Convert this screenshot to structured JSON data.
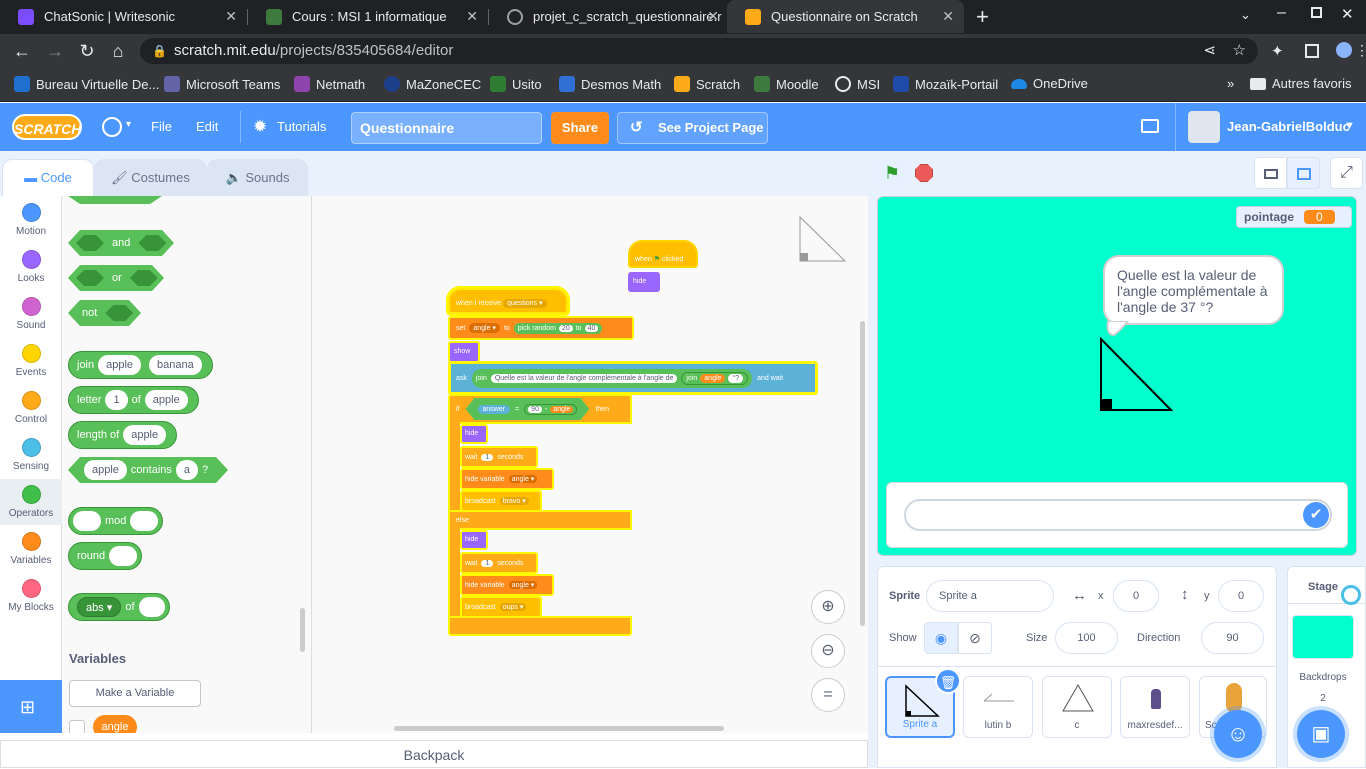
{
  "browser": {
    "tabs": [
      {
        "title": "ChatSonic | Writesonic",
        "color": "#7b4dff"
      },
      {
        "title": "Cours : MSI 1 informatique",
        "color": "#3d7a3d"
      },
      {
        "title": "projet_c_scratch_questionnaire.r",
        "color": "#5f6368"
      },
      {
        "title": "Questionnaire on Scratch",
        "color": "#ffab19"
      }
    ],
    "url_host": "scratch.mit.edu",
    "url_path": "/projects/835405684/editor",
    "bookmarks": [
      {
        "label": "Bureau Virtuelle De...",
        "color": "#1f6fd1"
      },
      {
        "label": "Microsoft Teams",
        "color": "#6264a7"
      },
      {
        "label": "Netmath",
        "color": "#8e44ad"
      },
      {
        "label": "MaZoneCEC",
        "color": "#1d3f8a"
      },
      {
        "label": "Usito",
        "color": "#2e7d32"
      },
      {
        "label": "Desmos Math",
        "color": "#2f6fd6"
      },
      {
        "label": "Scratch",
        "color": "#ffab19"
      },
      {
        "label": "Moodle",
        "color": "#3d7a3d"
      },
      {
        "label": "MSI",
        "color": "#e8eaed"
      },
      {
        "label": "Mozaïk-Portail",
        "color": "#1f4aa8"
      },
      {
        "label": "OneDrive",
        "color": "#1e88e5"
      }
    ],
    "other_bookmarks": "Autres favoris"
  },
  "menubar": {
    "logo": "SCRATCH",
    "file": "File",
    "edit": "Edit",
    "tutorials": "Tutorials",
    "project_title": "Questionnaire",
    "share": "Share",
    "see_project": "See Project Page",
    "username": "Jean-GabrielBolduc"
  },
  "editor_tabs": {
    "code": "Code",
    "costumes": "Costumes",
    "sounds": "Sounds"
  },
  "categories": [
    {
      "label": "Motion",
      "color": "#4c97ff"
    },
    {
      "label": "Looks",
      "color": "#9966ff"
    },
    {
      "label": "Sound",
      "color": "#cf63cf"
    },
    {
      "label": "Events",
      "color": "#ffd500"
    },
    {
      "label": "Control",
      "color": "#ffab19"
    },
    {
      "label": "Sensing",
      "color": "#4cbfe6"
    },
    {
      "label": "Operators",
      "color": "#40bf4a"
    },
    {
      "label": "Variables",
      "color": "#ff8c1a"
    },
    {
      "label": "My Blocks",
      "color": "#ff6680"
    }
  ],
  "palette": {
    "and": "and",
    "or": "or",
    "not": "not",
    "join": "join",
    "join_a": "apple",
    "join_b": "banana",
    "letter": "letter",
    "letter_n": "1",
    "letter_of": "of",
    "letter_s": "apple",
    "length_of": "length of",
    "length_s": "apple",
    "contains_a": "apple",
    "contains": "contains",
    "contains_b": "a",
    "contains_q": "?",
    "mod": "mod",
    "round": "round",
    "abs": "abs",
    "abs_of": "of",
    "variables_header": "Variables",
    "make_variable": "Make a Variable",
    "variable_angle": "angle"
  },
  "script": {
    "when_flag": "when",
    "clicked": "clicked",
    "hide1": "hide",
    "when_receive": "when I receive",
    "receive_msg": "questions",
    "set": "set",
    "set_var": "angle",
    "to": "to",
    "pick_random": "pick random",
    "rand_min": "20",
    "rand_to": "to",
    "rand_max": "40",
    "show": "show",
    "ask": "ask",
    "join1": "join",
    "question": "Quelle est la valeur de l'angle complémentale à l'angle de",
    "join2": "join",
    "join_var": "angle",
    "qmark": "°?",
    "and_wait": "and wait",
    "if": "if",
    "answer": "answer",
    "eq": "=",
    "ninety": "90",
    "minus": "-",
    "angle_v": "angle",
    "then": "then",
    "hide2": "hide",
    "wait1": "wait",
    "wait1_n": "1",
    "seconds1": "seconds",
    "hide_var1": "hide variable",
    "hide_var1_name": "angle",
    "broadcast1": "broadcast",
    "bravo": "bravo",
    "else": "else",
    "hide3": "hide",
    "wait2": "wait",
    "wait2_n": "1",
    "seconds2": "seconds",
    "hide_var2": "hide variable",
    "hide_var2_name": "angle",
    "broadcast2": "broadcast",
    "oups": "oups"
  },
  "backpack": "Backpack",
  "stage": {
    "monitor_label": "pointage",
    "monitor_value": "0",
    "speech": "Quelle est la valeur de l'angle complémentale à l'angle de 37 °?",
    "answer_value": ""
  },
  "sprite_info": {
    "sprite_label": "Sprite",
    "sprite_name": "Sprite a",
    "x_label": "x",
    "x": "0",
    "y_label": "y",
    "y": "0",
    "show_label": "Show",
    "size_label": "Size",
    "size": "100",
    "direction_label": "Direction",
    "direction": "90"
  },
  "sprites": [
    "Sprite a",
    "lutin b",
    "c",
    "maxresdef...",
    "Sc..."
  ],
  "stage_panel": {
    "title": "Stage",
    "backdrops_label": "Backdrops",
    "backdrops_count": "2"
  }
}
